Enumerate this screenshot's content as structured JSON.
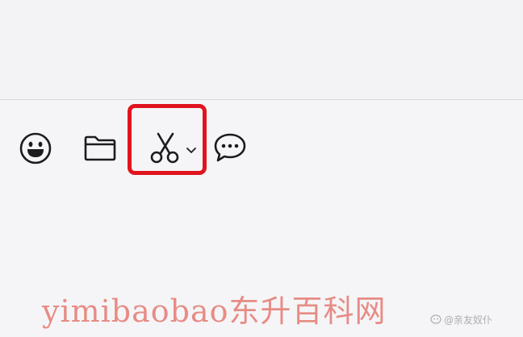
{
  "toolbar": {
    "icons": {
      "emoji": "emoji-smile-icon",
      "folder": "folder-icon",
      "screenshot": "scissors-icon",
      "dropdown": "chevron-down-icon",
      "chat": "chat-bubble-icon"
    }
  },
  "highlight": {
    "color": "#e0141e"
  },
  "watermark": {
    "main_text": "yimibaobao东升百科网",
    "small_text": "@亲友奴仆",
    "color": "#e57a72"
  }
}
